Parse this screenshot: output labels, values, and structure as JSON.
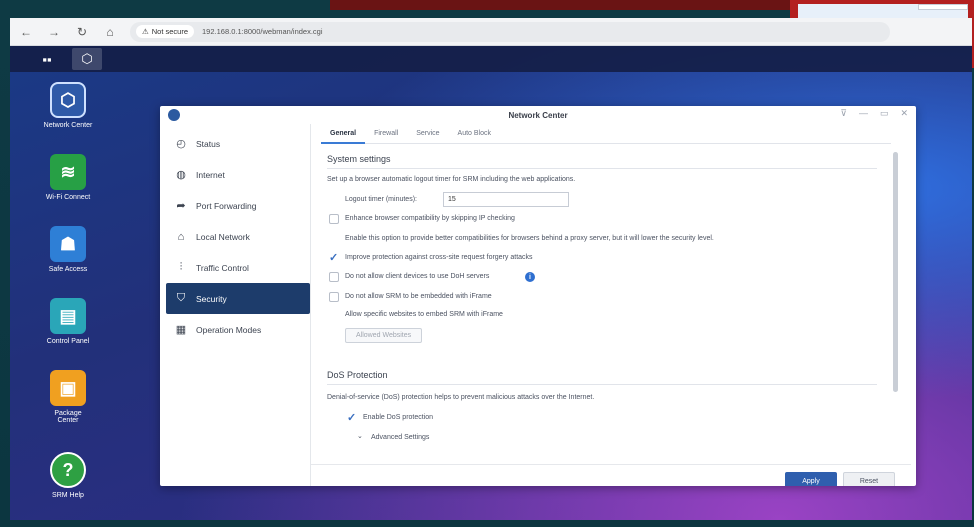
{
  "browser": {
    "not_secure": "Not secure",
    "url": "192.168.0.1:8000/webman/index.cgi"
  },
  "desktop_icons": [
    {
      "label": "Network Center",
      "icon": "network-center-icon"
    },
    {
      "label": "Wi-Fi Connect",
      "icon": "wifi-icon"
    },
    {
      "label": "Safe Access",
      "icon": "safe-access-icon"
    },
    {
      "label": "Control Panel",
      "icon": "control-panel-icon"
    },
    {
      "label": "Package\nCenter",
      "icon": "package-center-icon"
    },
    {
      "label": "SRM Help",
      "icon": "help-icon"
    }
  ],
  "window": {
    "title": "Network Center",
    "sidebar": [
      {
        "label": "Status",
        "icon": "status-icon"
      },
      {
        "label": "Internet",
        "icon": "globe-icon"
      },
      {
        "label": "Port Forwarding",
        "icon": "arrow-icon"
      },
      {
        "label": "Local Network",
        "icon": "house-icon"
      },
      {
        "label": "Traffic Control",
        "icon": "sliders-icon"
      },
      {
        "label": "Security",
        "icon": "shield-icon"
      },
      {
        "label": "Operation Modes",
        "icon": "router-icon"
      }
    ],
    "tabs": [
      "General",
      "Firewall",
      "Service",
      "Auto Block"
    ],
    "system_settings": {
      "title": "System settings",
      "desc": "Set up a browser automatic logout timer for SRM including the web applications.",
      "logout_label": "Logout timer (minutes):",
      "logout_value": "15",
      "enhance_label": "Enhance browser compatibility by skipping IP checking",
      "enhance_desc": "Enable this option to provide better compatibilities for browsers behind a proxy server, but it will lower the security level.",
      "csrf_label": "Improve protection against cross-site request forgery attacks",
      "doh_label": "Do not allow client devices to use DoH servers",
      "iframe_label": "Do not allow SRM to be embedded with iFrame",
      "iframe_desc": "Allow specific websites to embed SRM with iFrame",
      "allowed_btn": "Allowed Websites"
    },
    "dos": {
      "title": "DoS Protection",
      "desc": "Denial-of-service (DoS) protection helps to prevent malicious attacks over the Internet.",
      "enable_label": "Enable DoS protection",
      "advanced_label": "Advanced Settings"
    },
    "footer": {
      "apply": "Apply",
      "reset": "Reset"
    }
  }
}
